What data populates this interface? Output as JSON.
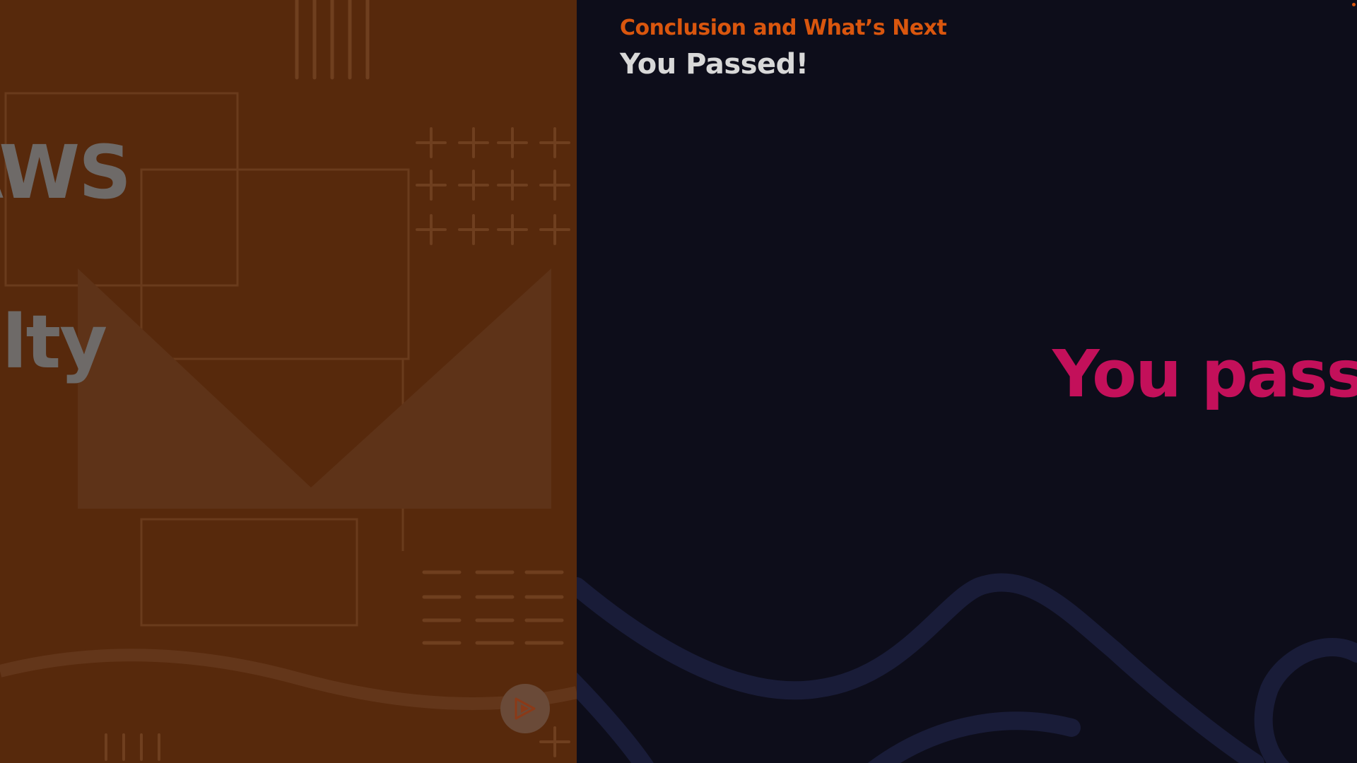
{
  "left_panel": {
    "word_top": "AWS",
    "word_bottom": "alty",
    "background_color": "#57290c",
    "play_icon": "play-icon"
  },
  "right_panel": {
    "section_label": "Conclusion and What’s Next",
    "title": "You Passed!",
    "headline": "You passe",
    "background_color": "#0d0d1a",
    "accent_color": "#d9560e",
    "headline_color": "#c3105a"
  }
}
